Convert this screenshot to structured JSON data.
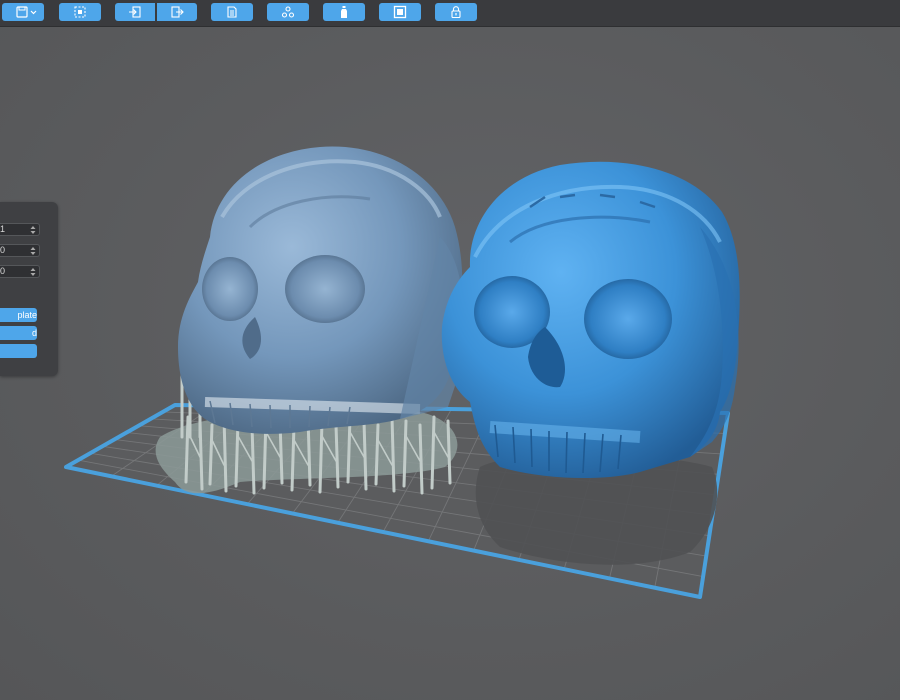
{
  "toolbar": {
    "buttons": [
      {
        "name": "save-dropdown-button",
        "icon": "save-icon"
      },
      {
        "name": "select-all-button",
        "icon": "select-icon"
      },
      {
        "name": "import-button",
        "icon": "import-icon"
      },
      {
        "name": "export-button",
        "icon": "export-icon"
      },
      {
        "name": "slice-button",
        "icon": "slice-icon"
      },
      {
        "name": "network-button",
        "icon": "network-icon"
      },
      {
        "name": "support-button",
        "icon": "bottle-icon"
      },
      {
        "name": "frame-button",
        "icon": "frame-icon"
      },
      {
        "name": "lock-button",
        "icon": "lock-icon"
      }
    ]
  },
  "side_panel": {
    "fields": [
      {
        "value": "1"
      },
      {
        "value": "0"
      },
      {
        "value": "0"
      }
    ],
    "buttons": [
      {
        "label": "plate"
      },
      {
        "label": "d"
      },
      {
        "label": ""
      }
    ]
  },
  "colors": {
    "accent": "#4ea6ea",
    "selected_model": "#3f96dc",
    "unselected_model": "#7a9ec2",
    "support": "#b8c3c0",
    "platform_border": "#4aa0dc"
  }
}
